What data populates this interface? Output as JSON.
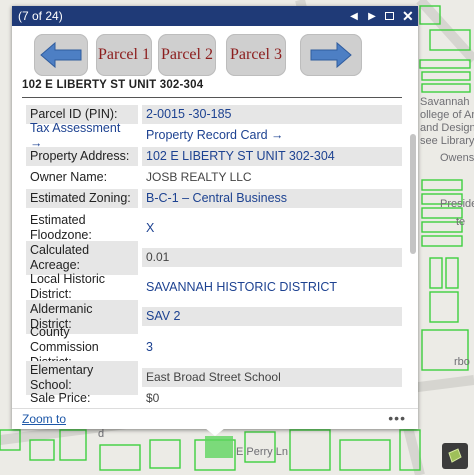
{
  "popup": {
    "counter": "(7 of 24)",
    "nav_buttons": [
      "Parcel 1",
      "Parcel 2",
      "Parcel 3"
    ],
    "address_heading": "102 E LIBERTY ST UNIT 302-304",
    "fields": [
      {
        "label": "Parcel ID (PIN):",
        "value": "2-0015 -30-185"
      },
      {
        "label": "Tax Assessment →",
        "value": "Property Record Card →"
      },
      {
        "label": "Property Address:",
        "value": "102 E LIBERTY ST UNIT 302-304"
      },
      {
        "label": "Owner Name:",
        "value": "JOSB REALTY LLC"
      },
      {
        "label": "Estimated Zoning:",
        "value": "B-C-1 – Central Business"
      },
      {
        "label": "Estimated Floodzone:",
        "value": "X"
      },
      {
        "label": "Calculated Acreage:",
        "value": "0.01"
      },
      {
        "label": "Local Historic District:",
        "value": "SAVANNAH HISTORIC DISTRICT"
      },
      {
        "label": "Aldermanic District:",
        "value": "SAV 2"
      },
      {
        "label": "County Commission District:",
        "value": "3"
      },
      {
        "label": "Elementary School:",
        "value": "East Broad Street School"
      },
      {
        "label": "Sale Price:",
        "value": "$0"
      }
    ],
    "zoom_to": "Zoom to",
    "more": "•••"
  },
  "map_labels": {
    "savannah_college": "Savannah\nollege of Art\nand Design\nsee Library",
    "owens": "Owens",
    "preside": "Preside",
    "rbo": "rbo",
    "te": "te",
    "e_perry": "E Perry Ln",
    "d": "d"
  },
  "colors": {
    "titlebar": "#1f3a77",
    "link": "#1d4291",
    "parcel_outline": "#3fcf3f",
    "nav_text": "#8c1c1c",
    "arrow_blue": "#4d7fc4"
  },
  "icons": {
    "prev": "triangle-left",
    "next": "triangle-right",
    "maximize": "square",
    "close": "x",
    "basemap": "layers"
  }
}
